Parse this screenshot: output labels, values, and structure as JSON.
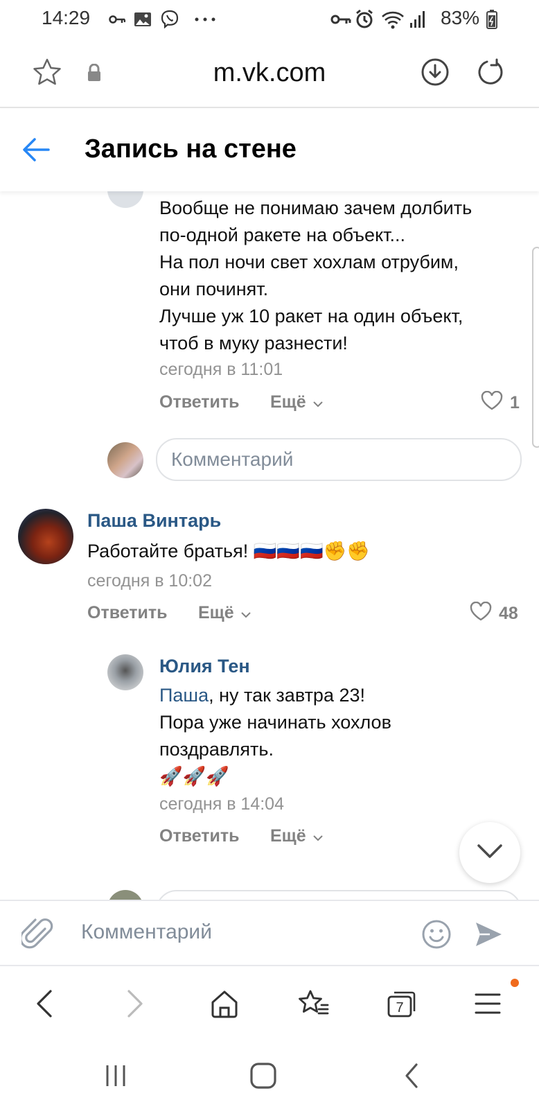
{
  "status_bar": {
    "time": "14:29",
    "battery": "83%",
    "icons": [
      "key-icon",
      "image-icon",
      "viber-icon",
      "more-dots-icon",
      "vpn-key-icon",
      "alarm-icon",
      "wifi-icon",
      "signal-icon",
      "battery-icon"
    ]
  },
  "browser": {
    "domain": "m.vk.com",
    "icons": [
      "star-icon",
      "lock-icon",
      "download-icon",
      "reload-icon"
    ]
  },
  "header": {
    "title": "Запись на стене"
  },
  "comments": [
    {
      "text_lines": [
        "Вообще не понимаю зачем долбить",
        "по-одной ракете на объект...",
        "На пол ночи свет хохлам отрубим,",
        "они починят.",
        "Лучше уж 10 ракет на один объект,",
        "чтоб в муку разнести!"
      ],
      "date": "сегодня в 11:01",
      "reply": "Ответить",
      "more": "Ещё",
      "likes": "1"
    },
    {
      "author": "Паша Винтарь",
      "text": "Работайте братья! ",
      "emoji": "🇷🇺🇷🇺🇷🇺✊✊",
      "date": "сегодня в 10:02",
      "reply": "Ответить",
      "more": "Ещё",
      "likes": "48"
    },
    {
      "author": "Юлия Тен",
      "mention": "Паша",
      "text_lines": [
        ", ну так завтра 23!",
        "Пора уже начинать хохлов",
        "поздравлять."
      ],
      "emoji": "🚀🚀🚀",
      "date": "сегодня в 14:04",
      "reply": "Ответить",
      "more": "Ещё"
    }
  ],
  "reply_input": {
    "placeholder": "Комментарий"
  },
  "comment_bar": {
    "placeholder": "Комментарий"
  },
  "browser_nav": {
    "tabs_count": "7"
  },
  "colors": {
    "link": "#2a5885",
    "accent": "#2787f5",
    "secondary": "#828282",
    "notification": "#f06a1c"
  }
}
